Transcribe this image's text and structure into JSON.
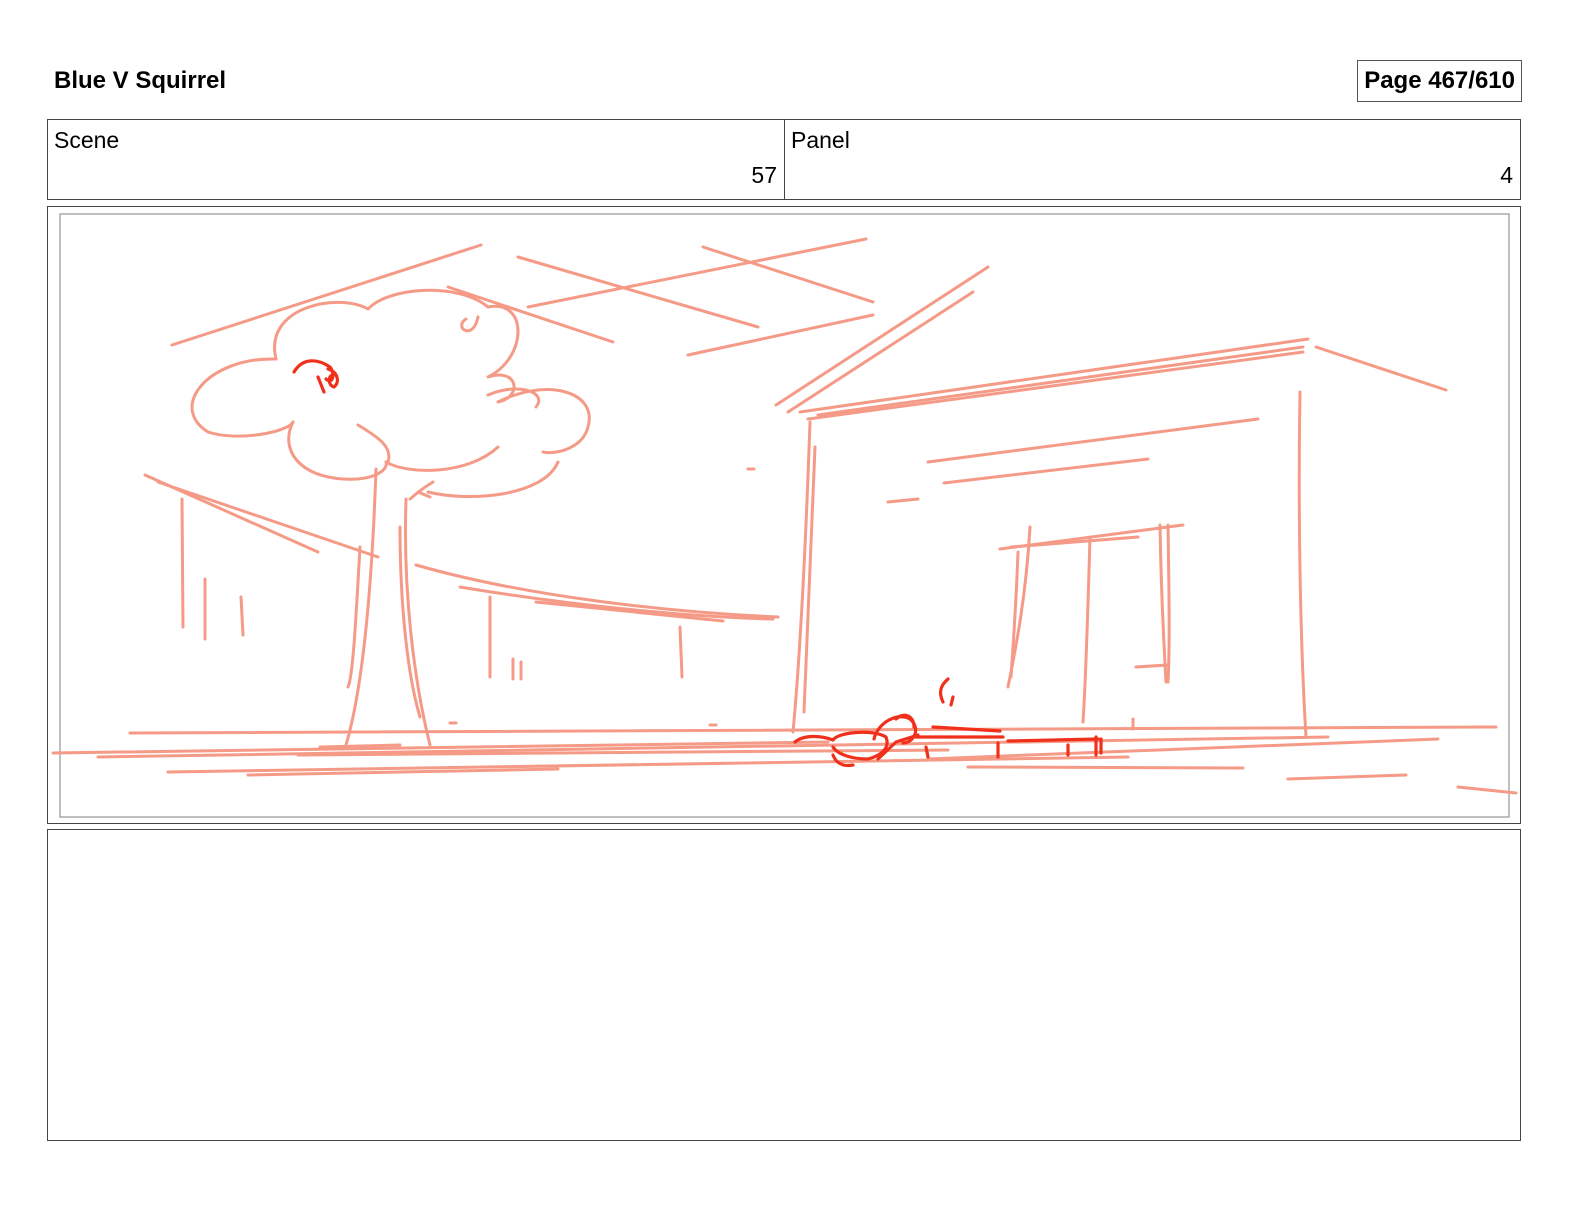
{
  "header": {
    "project_title": "Blue V Squirrel",
    "page_label": "Page 467/610"
  },
  "info": {
    "scene_label": "Scene",
    "scene_number": "57",
    "panel_label": "Panel",
    "panel_number": "4"
  },
  "panel": {
    "sketch_line_color": "#f59a86",
    "sketch_accent_color": "#f0301a",
    "inner_frame_color": "#aaaaaa"
  },
  "notes": {
    "text": ""
  }
}
